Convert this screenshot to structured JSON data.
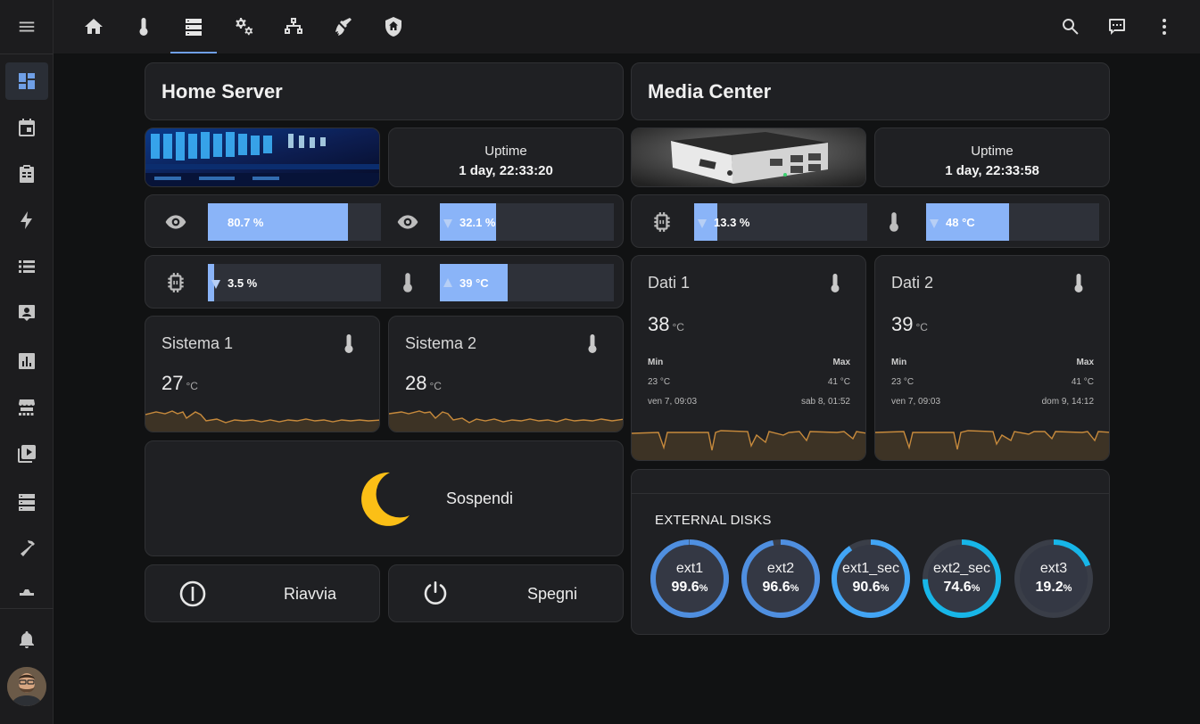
{
  "home_server": {
    "title": "Home Server",
    "uptime_label": "Uptime",
    "uptime_value": "1 day, 22:33:20",
    "bars": [
      {
        "icon": "eye-icon",
        "text": "80.7 %",
        "percent": 80.7,
        "arrow": "none"
      },
      {
        "icon": "eye-icon",
        "text": "32.1 %",
        "percent": 32.1,
        "arrow": "down"
      },
      {
        "icon": "cpu-chip-icon",
        "text": "3.5 %",
        "percent": 3.5,
        "arrow": "down"
      },
      {
        "icon": "thermometer-icon",
        "text": "39 °C",
        "percent": 39,
        "arrow": "up"
      }
    ],
    "sensors": [
      {
        "name": "Sistema 1",
        "value": "27",
        "unit": "°C"
      },
      {
        "name": "Sistema 2",
        "value": "28",
        "unit": "°C"
      }
    ],
    "suspend_label": "Sospendi",
    "restart_label": "Riavvia",
    "shutdown_label": "Spegni"
  },
  "media_center": {
    "title": "Media Center",
    "uptime_label": "Uptime",
    "uptime_value": "1 day, 22:33:58",
    "bars": [
      {
        "icon": "cpu-chip-icon",
        "text": "13.3 %",
        "percent": 13.3,
        "arrow": "down"
      },
      {
        "icon": "thermometer-icon",
        "text": "48 °C",
        "percent": 48,
        "arrow": "down"
      }
    ],
    "sensors": [
      {
        "name": "Dati 1",
        "value": "38",
        "unit": "°C",
        "min_label": "Min",
        "max_label": "Max",
        "min_value": "23 °C",
        "max_value": "41 °C",
        "min_time": "ven 7, 09:03",
        "max_time": "sab 8, 01:52"
      },
      {
        "name": "Dati 2",
        "value": "39",
        "unit": "°C",
        "min_label": "Min",
        "max_label": "Max",
        "min_value": "23 °C",
        "max_value": "41 °C",
        "min_time": "ven 7, 09:03",
        "max_time": "dom 9, 14:12"
      }
    ],
    "disks_title": "EXTERNAL DISKS",
    "disks": [
      {
        "name": "ext1",
        "value": "99.6",
        "unit": "%",
        "percent": 99.6,
        "color": "#4f8fe0"
      },
      {
        "name": "ext2",
        "value": "96.6",
        "unit": "%",
        "percent": 96.6,
        "color": "#4f8fe0"
      },
      {
        "name": "ext1_sec",
        "value": "90.6",
        "unit": "%",
        "percent": 90.6,
        "color": "#42a5f5"
      },
      {
        "name": "ext2_sec",
        "value": "74.6",
        "unit": "%",
        "percent": 74.6,
        "color": "#17b6e8"
      },
      {
        "name": "ext3",
        "value": "19.2",
        "unit": "%",
        "percent": 19.2,
        "color": "#17b6e8"
      }
    ]
  },
  "colors": {
    "accent": "#6f9fe6",
    "bar_fill": "#8ab4f8",
    "moon": "#fbbf16",
    "spark": "#c78a3c"
  }
}
